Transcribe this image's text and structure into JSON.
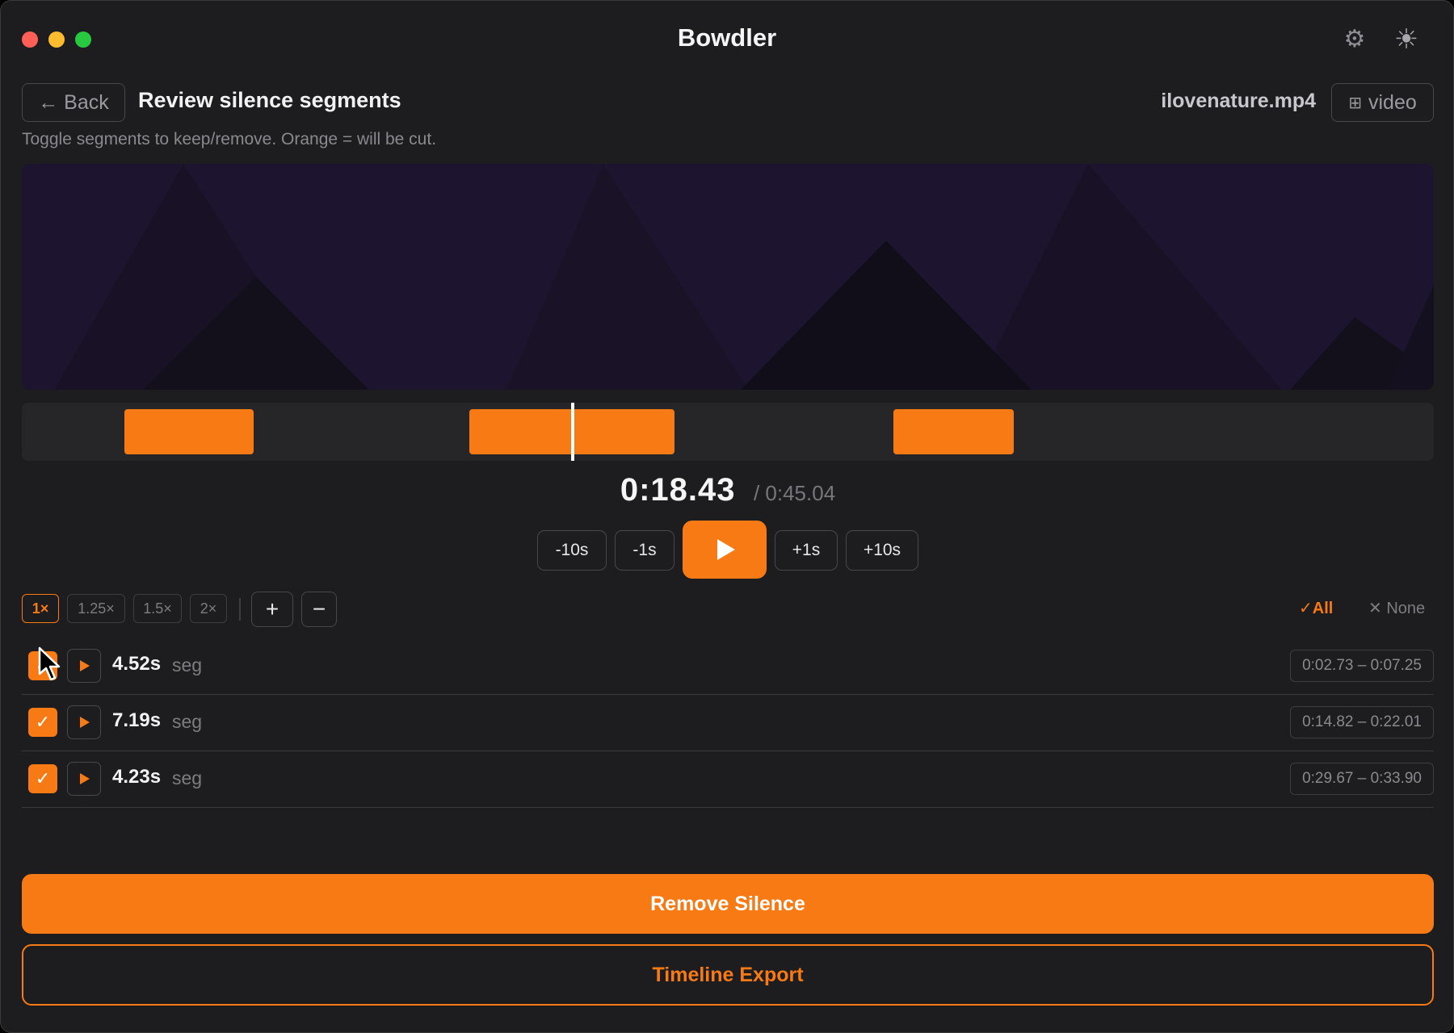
{
  "window": {
    "title": "Bowdler"
  },
  "icons": {
    "settings": "gear-icon",
    "theme": "sun-icon",
    "back": "arrow-left-icon",
    "video": "grid-icon",
    "play": "play-icon"
  },
  "header": {
    "back_label": "← Back",
    "page_title": "Review silence segments",
    "subtitle": "Toggle segments to keep/remove. Orange = will be cut.",
    "filename": "ilovenature.mp4",
    "video_label": "video"
  },
  "timeline": {
    "duration_seconds": 45.04,
    "playhead_seconds": 18.43,
    "segments": [
      {
        "start": 2.73,
        "end": 7.25
      },
      {
        "start": 14.82,
        "end": 22.01
      },
      {
        "start": 29.67,
        "end": 33.9
      }
    ]
  },
  "playback": {
    "current_time": "0:18.43",
    "total_time": "/ 0:45.04",
    "skip_back_10": "-10s",
    "skip_back_1": "-1s",
    "skip_fwd_1": "+1s",
    "skip_fwd_10": "+10s"
  },
  "speed": {
    "options": [
      "1×",
      "1.25×",
      "1.5×",
      "2×"
    ],
    "selected": "1×"
  },
  "zoom": {
    "in_label": "+",
    "out_label": "−"
  },
  "selection": {
    "all_label": "✓All",
    "none_label": "✕ None"
  },
  "segment_list": [
    {
      "checked": true,
      "duration": "4.52s",
      "label": "seg",
      "range": "0:02.73 – 0:07.25"
    },
    {
      "checked": true,
      "duration": "7.19s",
      "label": "seg",
      "range": "0:14.82 – 0:22.01"
    },
    {
      "checked": true,
      "duration": "4.23s",
      "label": "seg",
      "range": "0:29.67 – 0:33.90"
    }
  ],
  "actions": {
    "remove": "Remove Silence",
    "export": "Timeline Export"
  },
  "colors": {
    "accent": "#f77a14",
    "background": "#1d1d1f",
    "preview": "#1d1530"
  }
}
